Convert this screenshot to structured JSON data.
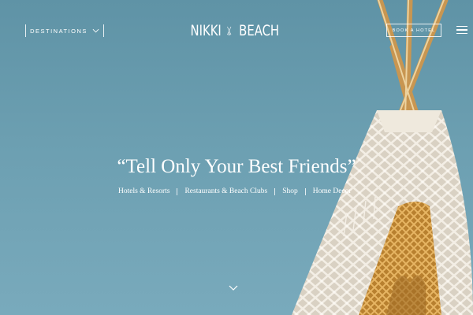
{
  "header": {
    "destinations_label": "DESTINATIONS",
    "logo_left": "NIKKI",
    "logo_right": "BEACH",
    "book_label": "BOOK A HOTEL"
  },
  "hero": {
    "headline": "“Tell Only Your Best Friends”",
    "nav": [
      {
        "label": "Hotels & Resorts"
      },
      {
        "label": "Restaurants & Beach Clubs"
      },
      {
        "label": "Shop"
      },
      {
        "label": "Home Decor"
      }
    ]
  },
  "icons": {
    "destinations_chevron": "chevron-down-icon",
    "menu": "hamburger-menu-icon",
    "scroll": "chevron-down-icon"
  },
  "colors": {
    "sky": "#6a9db0",
    "macrame": "#e9e2d6",
    "wood": "#c8904a",
    "text": "#ffffff"
  }
}
